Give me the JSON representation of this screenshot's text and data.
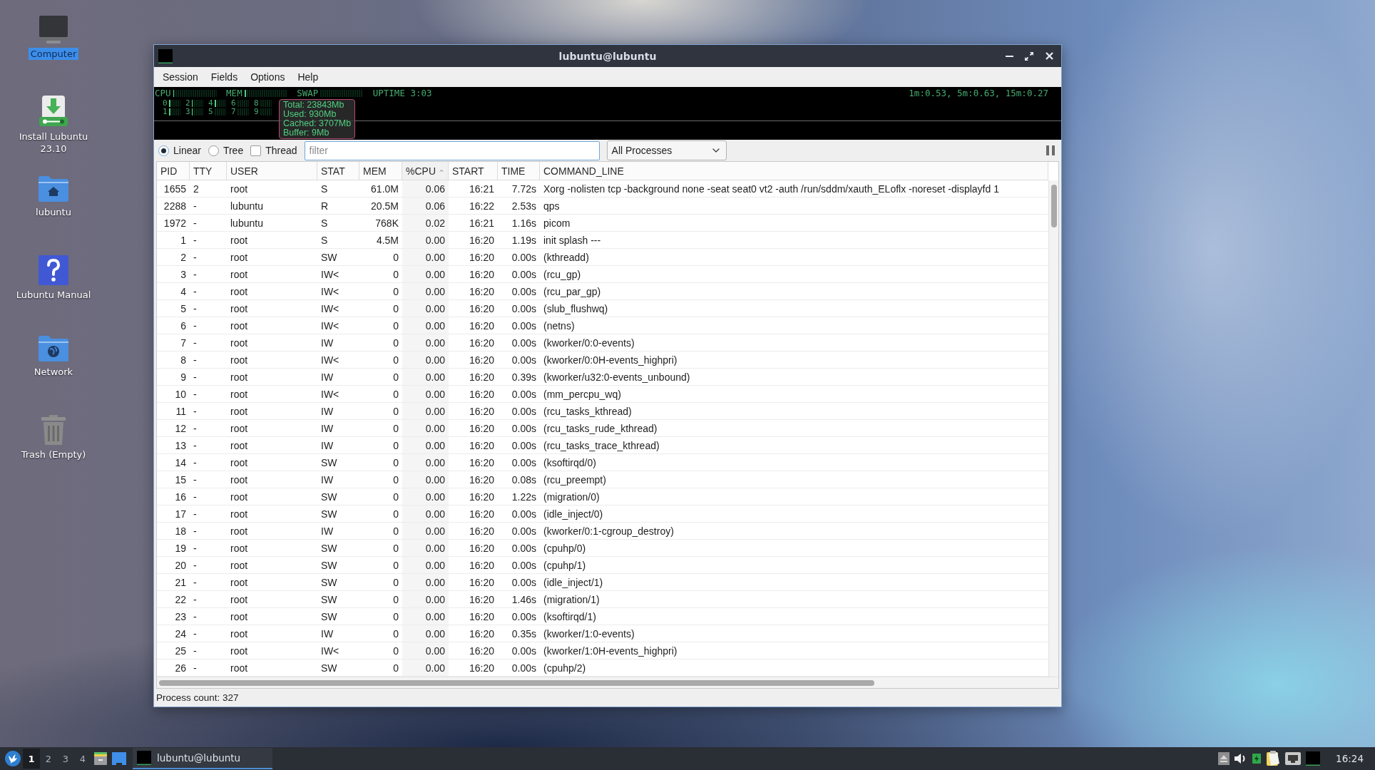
{
  "desktop_icons": [
    {
      "kind": "computer",
      "label": "Computer",
      "selected": true
    },
    {
      "kind": "installer",
      "label": "Install Lubuntu 23.10",
      "selected": false
    },
    {
      "kind": "home",
      "label": "lubuntu",
      "selected": false
    },
    {
      "kind": "help",
      "label": "Lubuntu Manual",
      "selected": false
    },
    {
      "kind": "network",
      "label": "Network",
      "selected": false
    },
    {
      "kind": "trash",
      "label": "Trash (Empty)",
      "selected": false
    }
  ],
  "window": {
    "title": "lubuntu@lubuntu"
  },
  "menu": [
    "Session",
    "Fields",
    "Options",
    "Help"
  ],
  "system_meters": {
    "bars": [
      {
        "label": "CPU",
        "level": 0.03
      },
      {
        "label": "MEM",
        "level": 0.06
      },
      {
        "label": "SWAP"
      }
    ],
    "uptime": "UPTIME 3:03",
    "load_average": "1m:0.53, 5m:0.63, 15m:0.27",
    "cores": [
      {
        "label": "0",
        "level": 0.15
      },
      {
        "label": "1",
        "level": 0.15
      },
      {
        "label": "2",
        "level": 0.1
      },
      {
        "label": "3",
        "level": 0.1
      },
      {
        "label": "4",
        "level": 0.15
      },
      {
        "label": "5",
        "level": 0.05
      },
      {
        "label": "6",
        "level": 0.05
      },
      {
        "label": "7",
        "level": 0.05
      },
      {
        "label": "8",
        "level": 0.05
      },
      {
        "label": "9",
        "level": 0.05
      }
    ]
  },
  "memory_tooltip": [
    "Total: 23843Mb",
    "Used: 930Mb",
    "Cached: 3707Mb",
    "Buffer: 9Mb"
  ],
  "view_modes": [
    {
      "label": "Linear",
      "selected": true
    },
    {
      "label": "Tree",
      "selected": false
    }
  ],
  "thread_option": {
    "label": "Thread",
    "checked": false
  },
  "filter": {
    "placeholder": "filter"
  },
  "process_scope": {
    "value": "All Processes"
  },
  "table": {
    "columns": [
      {
        "label": "PID",
        "sorted": false
      },
      {
        "label": "TTY",
        "sorted": false
      },
      {
        "label": "USER",
        "sorted": false
      },
      {
        "label": "STAT",
        "sorted": false
      },
      {
        "label": "MEM",
        "sorted": false
      },
      {
        "label": "%CPU",
        "sorted": true
      },
      {
        "label": "START",
        "sorted": false
      },
      {
        "label": "TIME",
        "sorted": false
      },
      {
        "label": "COMMAND_LINE",
        "sorted": false
      }
    ],
    "rows": [
      [
        "1655",
        "2",
        "root",
        "S",
        "61.0M",
        "0.06",
        "16:21",
        "7.72s",
        "Xorg -nolisten tcp -background none -seat seat0 vt2 -auth /run/sddm/xauth_ELoflx -noreset -displayfd 1"
      ],
      [
        "2288",
        "-",
        "lubuntu",
        "R",
        "20.5M",
        "0.06",
        "16:22",
        "2.53s",
        "qps"
      ],
      [
        "1972",
        "-",
        "lubuntu",
        "S",
        "768K",
        "0.02",
        "16:21",
        "1.16s",
        "picom"
      ],
      [
        "1",
        "-",
        "root",
        "S",
        "4.5M",
        "0.00",
        "16:20",
        "1.19s",
        "init splash ---"
      ],
      [
        "2",
        "-",
        "root",
        "SW",
        "0",
        "0.00",
        "16:20",
        "0.00s",
        "(kthreadd)"
      ],
      [
        "3",
        "-",
        "root",
        "IW<",
        "0",
        "0.00",
        "16:20",
        "0.00s",
        "(rcu_gp)"
      ],
      [
        "4",
        "-",
        "root",
        "IW<",
        "0",
        "0.00",
        "16:20",
        "0.00s",
        "(rcu_par_gp)"
      ],
      [
        "5",
        "-",
        "root",
        "IW<",
        "0",
        "0.00",
        "16:20",
        "0.00s",
        "(slub_flushwq)"
      ],
      [
        "6",
        "-",
        "root",
        "IW<",
        "0",
        "0.00",
        "16:20",
        "0.00s",
        "(netns)"
      ],
      [
        "7",
        "-",
        "root",
        "IW",
        "0",
        "0.00",
        "16:20",
        "0.00s",
        "(kworker/0:0-events)"
      ],
      [
        "8",
        "-",
        "root",
        "IW<",
        "0",
        "0.00",
        "16:20",
        "0.00s",
        "(kworker/0:0H-events_highpri)"
      ],
      [
        "9",
        "-",
        "root",
        "IW",
        "0",
        "0.00",
        "16:20",
        "0.39s",
        "(kworker/u32:0-events_unbound)"
      ],
      [
        "10",
        "-",
        "root",
        "IW<",
        "0",
        "0.00",
        "16:20",
        "0.00s",
        "(mm_percpu_wq)"
      ],
      [
        "11",
        "-",
        "root",
        "IW",
        "0",
        "0.00",
        "16:20",
        "0.00s",
        "(rcu_tasks_kthread)"
      ],
      [
        "12",
        "-",
        "root",
        "IW",
        "0",
        "0.00",
        "16:20",
        "0.00s",
        "(rcu_tasks_rude_kthread)"
      ],
      [
        "13",
        "-",
        "root",
        "IW",
        "0",
        "0.00",
        "16:20",
        "0.00s",
        "(rcu_tasks_trace_kthread)"
      ],
      [
        "14",
        "-",
        "root",
        "SW",
        "0",
        "0.00",
        "16:20",
        "0.00s",
        "(ksoftirqd/0)"
      ],
      [
        "15",
        "-",
        "root",
        "IW",
        "0",
        "0.00",
        "16:20",
        "0.08s",
        "(rcu_preempt)"
      ],
      [
        "16",
        "-",
        "root",
        "SW",
        "0",
        "0.00",
        "16:20",
        "1.22s",
        "(migration/0)"
      ],
      [
        "17",
        "-",
        "root",
        "SW",
        "0",
        "0.00",
        "16:20",
        "0.00s",
        "(idle_inject/0)"
      ],
      [
        "18",
        "-",
        "root",
        "IW",
        "0",
        "0.00",
        "16:20",
        "0.00s",
        "(kworker/0:1-cgroup_destroy)"
      ],
      [
        "19",
        "-",
        "root",
        "SW",
        "0",
        "0.00",
        "16:20",
        "0.00s",
        "(cpuhp/0)"
      ],
      [
        "20",
        "-",
        "root",
        "SW",
        "0",
        "0.00",
        "16:20",
        "0.00s",
        "(cpuhp/1)"
      ],
      [
        "21",
        "-",
        "root",
        "SW",
        "0",
        "0.00",
        "16:20",
        "0.00s",
        "(idle_inject/1)"
      ],
      [
        "22",
        "-",
        "root",
        "SW",
        "0",
        "0.00",
        "16:20",
        "1.46s",
        "(migration/1)"
      ],
      [
        "23",
        "-",
        "root",
        "SW",
        "0",
        "0.00",
        "16:20",
        "0.00s",
        "(ksoftirqd/1)"
      ],
      [
        "24",
        "-",
        "root",
        "IW",
        "0",
        "0.00",
        "16:20",
        "0.35s",
        "(kworker/1:0-events)"
      ],
      [
        "25",
        "-",
        "root",
        "IW<",
        "0",
        "0.00",
        "16:20",
        "0.00s",
        "(kworker/1:0H-events_highpri)"
      ],
      [
        "26",
        "-",
        "root",
        "SW",
        "0",
        "0.00",
        "16:20",
        "0.00s",
        "(cpuhp/2)"
      ]
    ]
  },
  "status_bar": "Process count: 327",
  "taskbar": {
    "workspaces": [
      {
        "label": "1",
        "selected": true
      },
      {
        "label": "2",
        "selected": false
      },
      {
        "label": "3",
        "selected": false
      },
      {
        "label": "4",
        "selected": false
      }
    ],
    "tasks": [
      {
        "label": "lubuntu@lubuntu",
        "selected": true
      }
    ],
    "clock": "16:24"
  }
}
